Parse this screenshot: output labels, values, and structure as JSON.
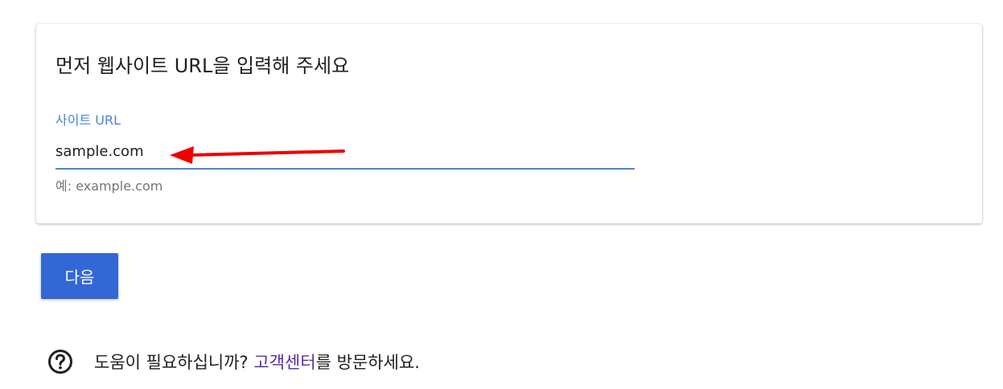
{
  "card": {
    "title": "먼저 웹사이트 URL을 입력해 주세요",
    "field_label": "사이트 URL",
    "url_value": "sample.com",
    "helper_text": "예: example.com"
  },
  "next_button_label": "다음",
  "help": {
    "icon": "help-circle-icon",
    "text_before": "도움이 필요하십니까? ",
    "link_text": "고객센터",
    "text_after": "를 방문하세요."
  },
  "colors": {
    "accent_blue": "#4a86d8",
    "button_blue": "#3367d6",
    "link_purple": "#5a2ea6",
    "annotation_arrow_red": "#ee0000"
  }
}
